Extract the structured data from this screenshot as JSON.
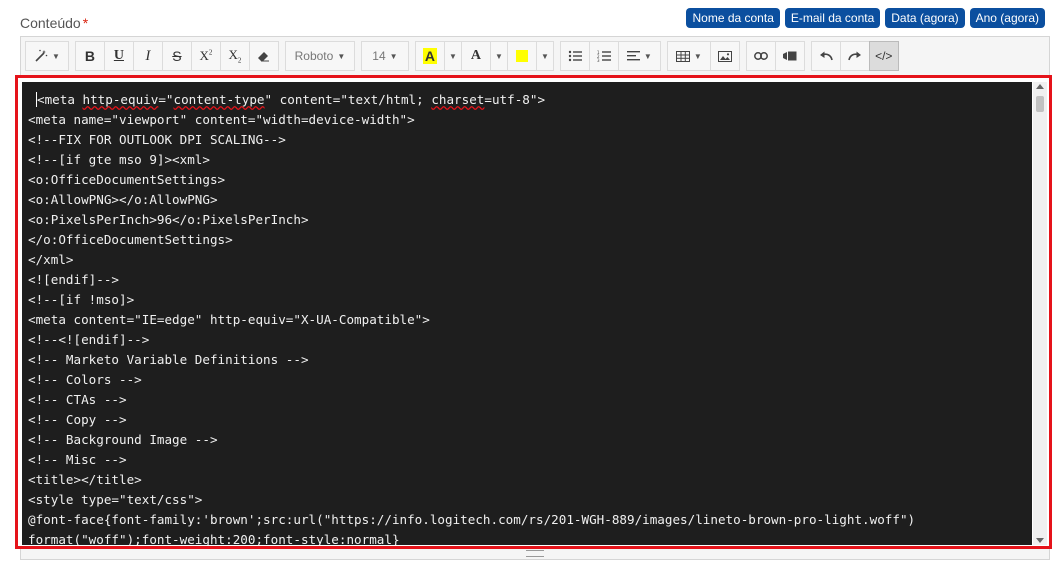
{
  "field": {
    "label": "Conteúdo",
    "required_mark": "*"
  },
  "insert_buttons": [
    "Nome da conta",
    "E-mail da conta",
    "Data (agora)",
    "Ano (agora)"
  ],
  "toolbar": {
    "font_name": "Roboto",
    "font_size": "14",
    "highlight_letter": "A",
    "font_color_letter": "A",
    "code_view_label": "</>"
  },
  "code_lines": [
    "<meta http-equiv=\"content-type\" content=\"text/html; charset=utf-8\">",
    "<meta name=\"viewport\" content=\"width=device-width\">",
    "<!--FIX FOR OUTLOOK DPI SCALING-->",
    "<!--[if gte mso 9]><xml>",
    "<o:OfficeDocumentSettings>",
    "<o:AllowPNG></o:AllowPNG>",
    "<o:PixelsPerInch>96</o:PixelsPerInch>",
    "</o:OfficeDocumentSettings>",
    "</xml>",
    "<![endif]-->",
    "<!--[if !mso]>",
    "<meta content=\"IE=edge\" http-equiv=\"X-UA-Compatible\">",
    "<!--<![endif]-->",
    "<!-- Marketo Variable Definitions -->",
    "<!-- Colors -->",
    "<!-- CTAs -->",
    "<!-- Copy -->",
    "<!-- Background Image -->",
    "<!-- Misc -->",
    "<title></title>",
    "<style type=\"text/css\">",
    "@font-face{font-family:'brown';src:url(\"https://info.logitech.com/rs/201-WGH-889/images/lineto-brown-pro-light.woff\")",
    "format(\"woff\");font-weight:200;font-style:normal}"
  ],
  "colors": {
    "insert_button_bg": "#0b4f9f",
    "code_bg": "#1e1e1e",
    "highlight_border": "#e5131a",
    "highlight_swatch": "#ffff00"
  }
}
